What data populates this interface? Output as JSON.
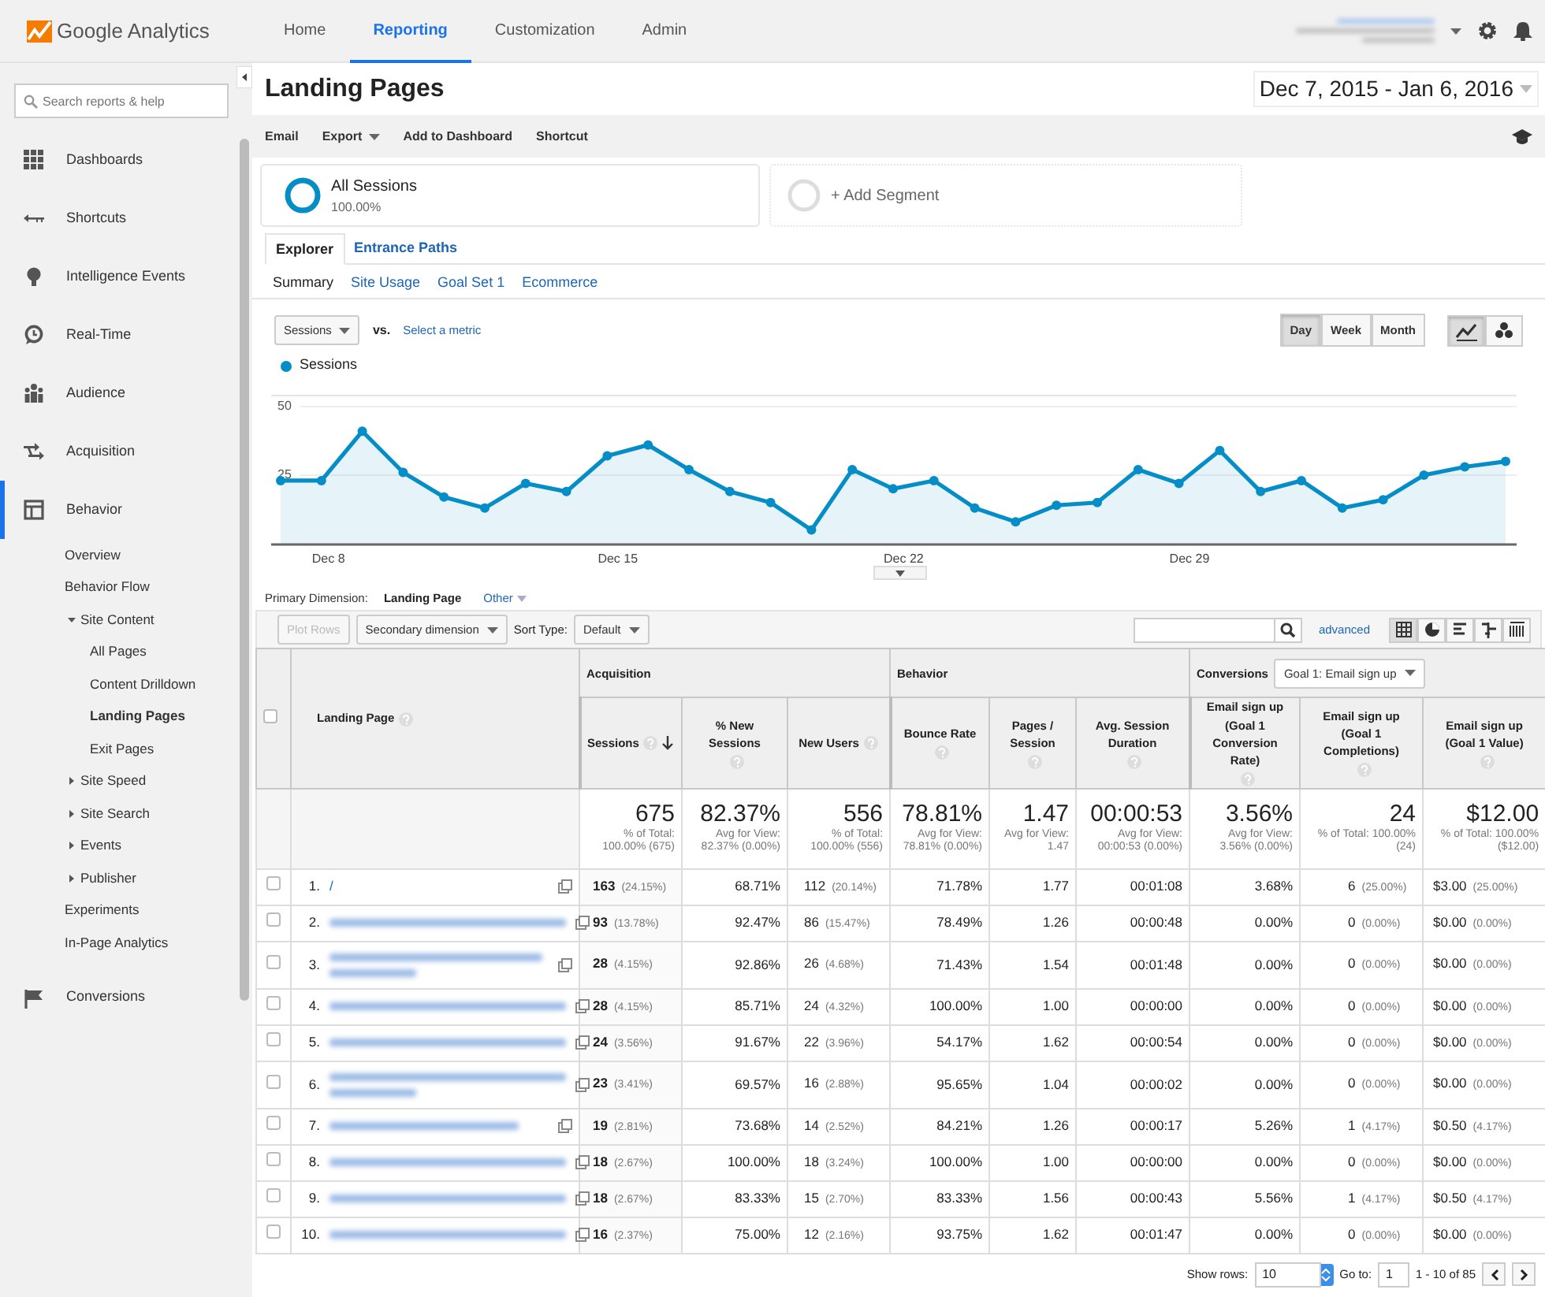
{
  "topbar": {
    "logo": "Google Analytics",
    "nav": [
      {
        "label": "Home",
        "selected": false
      },
      {
        "label": "Reporting",
        "selected": true
      },
      {
        "label": "Customization",
        "selected": false
      },
      {
        "label": "Admin",
        "selected": false
      }
    ]
  },
  "sidebar": {
    "search": {
      "placeholder": "Search reports & help"
    },
    "items": [
      {
        "label": "Dashboards",
        "selected": false
      },
      {
        "label": "Shortcuts",
        "selected": false
      },
      {
        "label": "Intelligence Events",
        "selected": false
      },
      {
        "label": "Real-Time",
        "selected": false
      },
      {
        "label": "Audience",
        "selected": false
      },
      {
        "label": "Acquisition",
        "selected": false
      },
      {
        "label": "Behavior",
        "selected": true,
        "children": [
          {
            "label": "Overview",
            "selected": false
          },
          {
            "label": "Behavior Flow",
            "selected": false
          },
          {
            "label": "Site Content",
            "selected": false,
            "expanded": true,
            "children": [
              {
                "label": "All Pages",
                "selected": false
              },
              {
                "label": "Content Drilldown",
                "selected": false
              },
              {
                "label": "Landing Pages",
                "selected": true
              },
              {
                "label": "Exit Pages",
                "selected": false
              }
            ]
          },
          {
            "label": "Site Speed",
            "selected": false,
            "expanded": false
          },
          {
            "label": "Site Search",
            "selected": false,
            "expanded": false
          },
          {
            "label": "Events",
            "selected": false,
            "expanded": false
          },
          {
            "label": "Publisher",
            "selected": false,
            "expanded": false
          },
          {
            "label": "Experiments",
            "selected": false
          },
          {
            "label": "In-Page Analytics",
            "selected": false
          }
        ]
      },
      {
        "label": "Conversions",
        "selected": false
      }
    ]
  },
  "report": {
    "title": "Landing Pages",
    "date_range": "Dec 7, 2015 - Jan 6, 2016",
    "actions": [
      {
        "label": "Email",
        "dropdown": false
      },
      {
        "label": "Export",
        "dropdown": true
      },
      {
        "label": "Add to Dashboard",
        "dropdown": false
      },
      {
        "label": "Shortcut",
        "dropdown": false
      }
    ],
    "segments": [
      {
        "kind": "active",
        "name": "All Sessions",
        "share": "100.00%"
      },
      {
        "kind": "add",
        "name": "+ Add Segment"
      }
    ],
    "tabs": [
      {
        "label": "Explorer",
        "selected": true
      },
      {
        "label": "Entrance Paths",
        "selected": false
      }
    ],
    "subtabs": [
      {
        "label": "Summary",
        "selected": true
      },
      {
        "label": "Site Usage",
        "selected": false
      },
      {
        "label": "Goal Set 1",
        "selected": false
      },
      {
        "label": "Ecommerce",
        "selected": false
      }
    ]
  },
  "chart": {
    "metric": "Sessions",
    "vs": "vs.",
    "compare": "Select a metric",
    "periods": [
      {
        "label": "Day",
        "selected": true
      },
      {
        "label": "Week",
        "selected": false
      },
      {
        "label": "Month",
        "selected": false
      }
    ],
    "chart_types": [
      {
        "kind": "line",
        "selected": true
      },
      {
        "kind": "motion",
        "selected": false
      }
    ],
    "chart_data": {
      "type": "area",
      "categories": [
        null,
        "Dec 8",
        null,
        null,
        null,
        null,
        null,
        null,
        "Dec 15",
        null,
        null,
        null,
        null,
        null,
        null,
        "Dec 22",
        null,
        null,
        null,
        null,
        null,
        null,
        "Dec 29",
        null,
        null,
        null,
        null,
        null,
        null,
        null,
        null
      ],
      "series": [
        {
          "name": "Sessions",
          "color": "#058dc7",
          "values": [
            23,
            23,
            41,
            26,
            17,
            13,
            22,
            19,
            32,
            36,
            27,
            19,
            15,
            5,
            27,
            20,
            23,
            13,
            8,
            14,
            15,
            27,
            22,
            34,
            19,
            23,
            13,
            16,
            25,
            28,
            30
          ]
        }
      ],
      "ylim": [
        0,
        54
      ],
      "yticks": [
        {
          "value": 25,
          "label": "25"
        },
        {
          "value": 50,
          "label": "50"
        }
      ]
    }
  },
  "dimension": {
    "label": "Primary Dimension:",
    "options": [
      {
        "label": "Landing Page",
        "selected": true
      },
      {
        "label": "Other",
        "selected": false
      }
    ]
  },
  "table_tools": {
    "plot_rows": {
      "label": "Plot Rows",
      "disabled": true
    },
    "secondary": "Secondary dimension",
    "sort_label": "Sort Type:",
    "sort_value": "Default",
    "advanced": "advanced",
    "views": [
      {
        "kind": "table",
        "selected": true
      },
      {
        "kind": "pie",
        "selected": false
      },
      {
        "kind": "bars",
        "selected": false
      },
      {
        "kind": "comparison",
        "selected": false
      },
      {
        "kind": "pivot",
        "selected": false
      }
    ]
  },
  "table": {
    "groups": [
      "Acquisition",
      "Behavior",
      "Conversions"
    ],
    "goal": "Goal 1: Email sign up",
    "page_column": {
      "label": "Landing Page"
    },
    "columns": [
      {
        "label": "Sessions",
        "sorted": true
      },
      {
        "label": "% New Sessions",
        "sorted": false
      },
      {
        "label": "New Users",
        "sorted": false
      },
      {
        "label": "Bounce Rate",
        "sorted": false
      },
      {
        "label": "Pages / Session",
        "sorted": false
      },
      {
        "label": "Avg. Session Duration",
        "sorted": false
      },
      {
        "label": "Email sign up (Goal 1 Conversion Rate)",
        "sorted": false
      },
      {
        "label": "Email sign up (Goal 1 Completions)",
        "sorted": false
      },
      {
        "label": "Email sign up (Goal 1 Value)",
        "sorted": false
      }
    ],
    "all_checked": false,
    "totals": [
      {
        "value": "675",
        "note": "% of Total: 100.00% (675)"
      },
      {
        "value": "82.37%",
        "note": "Avg for View: 82.37% (0.00%)"
      },
      {
        "value": "556",
        "note": "% of Total: 100.00% (556)"
      },
      {
        "value": "78.81%",
        "note": "Avg for View: 78.81% (0.00%)"
      },
      {
        "value": "1.47",
        "note": "Avg for View: 1.47"
      },
      {
        "value": "00:00:53",
        "note": "Avg for View: 00:00:53 (0.00%)"
      },
      {
        "value": "3.56%",
        "note": "Avg for View: 3.56% (0.00%)"
      },
      {
        "value": "24",
        "note": "% of Total: 100.00% (24)"
      },
      {
        "value": "$12.00",
        "note": "% of Total: 100.00% ($12.00)"
      }
    ],
    "rows": [
      {
        "number": "1.",
        "checked": false,
        "page": {
          "kind": "link",
          "text": "/"
        },
        "cells": [
          [
            "163",
            "(24.15%)"
          ],
          [
            "68.71%"
          ],
          [
            "112",
            "(20.14%)"
          ],
          [
            "71.78%"
          ],
          [
            "1.77"
          ],
          [
            "00:01:08"
          ],
          [
            "3.68%"
          ],
          [
            "6",
            "(25.00%)"
          ],
          [
            "$3.00",
            "(25.00%)"
          ]
        ]
      },
      {
        "number": "2.",
        "checked": false,
        "page": {
          "kind": "blurred"
        },
        "cells": [
          [
            "93",
            "(13.78%)"
          ],
          [
            "92.47%"
          ],
          [
            "86",
            "(15.47%)"
          ],
          [
            "78.49%"
          ],
          [
            "1.26"
          ],
          [
            "00:00:48"
          ],
          [
            "0.00%"
          ],
          [
            "0",
            "(0.00%)"
          ],
          [
            "$0.00",
            "(0.00%)"
          ]
        ]
      },
      {
        "number": "3.",
        "checked": false,
        "page": {
          "kind": "blurred-wrapped"
        },
        "cells": [
          [
            "28",
            "(4.15%)"
          ],
          [
            "92.86%"
          ],
          [
            "26",
            "(4.68%)"
          ],
          [
            "71.43%"
          ],
          [
            "1.54"
          ],
          [
            "00:01:48"
          ],
          [
            "0.00%"
          ],
          [
            "0",
            "(0.00%)"
          ],
          [
            "$0.00",
            "(0.00%)"
          ]
        ]
      },
      {
        "number": "4.",
        "checked": false,
        "page": {
          "kind": "blurred"
        },
        "cells": [
          [
            "28",
            "(4.15%)"
          ],
          [
            "85.71%"
          ],
          [
            "24",
            "(4.32%)"
          ],
          [
            "100.00%"
          ],
          [
            "1.00"
          ],
          [
            "00:00:00"
          ],
          [
            "0.00%"
          ],
          [
            "0",
            "(0.00%)"
          ],
          [
            "$0.00",
            "(0.00%)"
          ]
        ]
      },
      {
        "number": "5.",
        "checked": false,
        "page": {
          "kind": "blurred"
        },
        "cells": [
          [
            "24",
            "(3.56%)"
          ],
          [
            "91.67%"
          ],
          [
            "22",
            "(3.96%)"
          ],
          [
            "54.17%"
          ],
          [
            "1.62"
          ],
          [
            "00:00:54"
          ],
          [
            "0.00%"
          ],
          [
            "0",
            "(0.00%)"
          ],
          [
            "$0.00",
            "(0.00%)"
          ]
        ]
      },
      {
        "number": "6.",
        "checked": false,
        "page": {
          "kind": "blurred-wrapped"
        },
        "cells": [
          [
            "23",
            "(3.41%)"
          ],
          [
            "69.57%"
          ],
          [
            "16",
            "(2.88%)"
          ],
          [
            "95.65%"
          ],
          [
            "1.04"
          ],
          [
            "00:00:02"
          ],
          [
            "0.00%"
          ],
          [
            "0",
            "(0.00%)"
          ],
          [
            "$0.00",
            "(0.00%)"
          ]
        ]
      },
      {
        "number": "7.",
        "checked": false,
        "page": {
          "kind": "blurred"
        },
        "cells": [
          [
            "19",
            "(2.81%)"
          ],
          [
            "73.68%"
          ],
          [
            "14",
            "(2.52%)"
          ],
          [
            "84.21%"
          ],
          [
            "1.26"
          ],
          [
            "00:00:17"
          ],
          [
            "5.26%"
          ],
          [
            "1",
            "(4.17%)"
          ],
          [
            "$0.50",
            "(4.17%)"
          ]
        ]
      },
      {
        "number": "8.",
        "checked": false,
        "page": {
          "kind": "blurred"
        },
        "cells": [
          [
            "18",
            "(2.67%)"
          ],
          [
            "100.00%"
          ],
          [
            "18",
            "(3.24%)"
          ],
          [
            "100.00%"
          ],
          [
            "1.00"
          ],
          [
            "00:00:00"
          ],
          [
            "0.00%"
          ],
          [
            "0",
            "(0.00%)"
          ],
          [
            "$0.00",
            "(0.00%)"
          ]
        ]
      },
      {
        "number": "9.",
        "checked": false,
        "page": {
          "kind": "blurred"
        },
        "cells": [
          [
            "18",
            "(2.67%)"
          ],
          [
            "83.33%"
          ],
          [
            "15",
            "(2.70%)"
          ],
          [
            "83.33%"
          ],
          [
            "1.56"
          ],
          [
            "00:00:43"
          ],
          [
            "5.56%"
          ],
          [
            "1",
            "(4.17%)"
          ],
          [
            "$0.50",
            "(4.17%)"
          ]
        ]
      },
      {
        "number": "10.",
        "checked": false,
        "page": {
          "kind": "blurred"
        },
        "cells": [
          [
            "16",
            "(2.37%)"
          ],
          [
            "75.00%"
          ],
          [
            "12",
            "(2.16%)"
          ],
          [
            "93.75%"
          ],
          [
            "1.62"
          ],
          [
            "00:01:47"
          ],
          [
            "0.00%"
          ],
          [
            "0",
            "(0.00%)"
          ],
          [
            "$0.00",
            "(0.00%)"
          ]
        ]
      }
    ]
  },
  "pager": {
    "show_rows_label": "Show rows:",
    "show_rows": "10",
    "goto_label": "Go to:",
    "goto": "1",
    "range": "1 - 10 of 85"
  }
}
